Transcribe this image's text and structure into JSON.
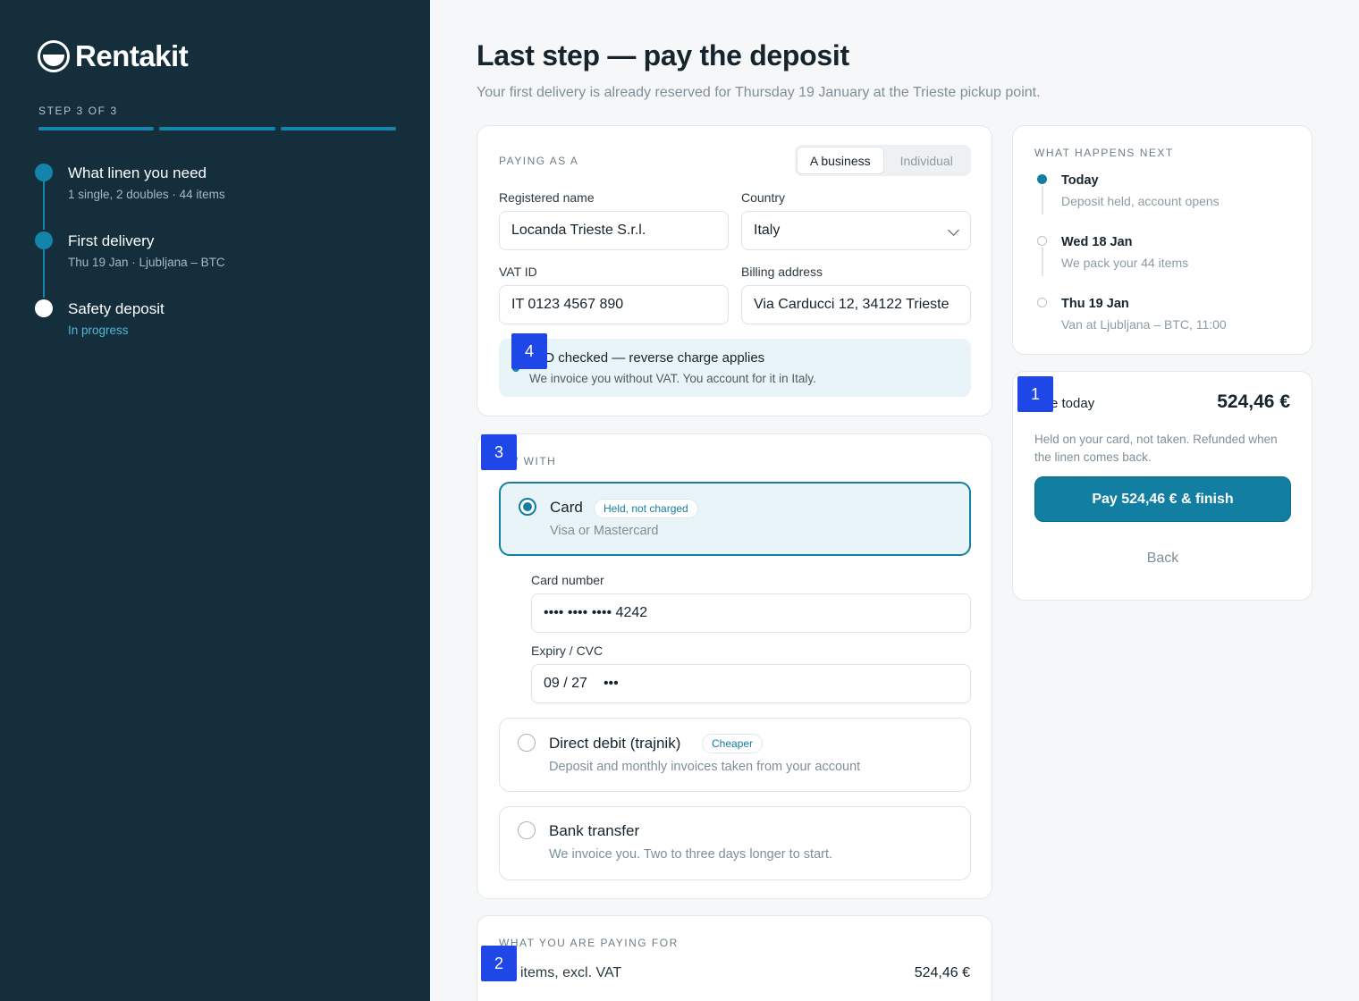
{
  "brand": {
    "name": "Rentakit"
  },
  "sidebar": {
    "step_label": "STEP 3 OF 3",
    "steps": [
      {
        "title": "What linen you need",
        "sub": "1 single, 2 doubles · 44 items"
      },
      {
        "title": "First delivery",
        "sub": "Thu 19 Jan · Ljubljana – BTC"
      },
      {
        "title": "Safety deposit",
        "sub": "In progress"
      }
    ]
  },
  "header": {
    "title": "Last step — pay the deposit",
    "subtitle": "Your first delivery is already reserved for Thursday 19 January at the Trieste pickup point."
  },
  "paying_as": {
    "label": "PAYING AS A",
    "options": [
      "A business",
      "Individual"
    ],
    "selected": "A business",
    "registered_name_label": "Registered name",
    "registered_name": "Locanda Trieste S.r.l.",
    "country_label": "Country",
    "country": "Italy",
    "vat_label": "VAT ID",
    "vat": "IT 0123 4567 890",
    "billing_label": "Billing address",
    "billing": "Via Carducci 12, 34122 Trieste",
    "vat_note_title": "T ID checked — reverse charge applies",
    "vat_note_sub": "We invoice you without VAT. You account for it in Italy."
  },
  "pay_with": {
    "label": "/ WITH",
    "card": {
      "title": "Card",
      "badge": "Held, not charged",
      "sub": "Visa or Mastercard"
    },
    "card_number_label": "Card number",
    "card_number": "•••• •••• •••• 4242",
    "expiry_label": "Expiry / CVC",
    "expiry": "09 / 27",
    "cvc": "•••",
    "debit": {
      "title": "Direct debit (trajnik)",
      "badge": "Cheaper",
      "sub": "Deposit and monthly invoices taken from your account"
    },
    "bank": {
      "title": "Bank transfer",
      "sub": "We invoice you. Two to three days longer to start."
    }
  },
  "paying_for": {
    "label": "WHAT YOU ARE PAYING FOR",
    "line_label": "items, excl. VAT",
    "line_amount": "524,46 €"
  },
  "next": {
    "label": "WHAT HAPPENS NEXT",
    "items": [
      {
        "title": "Today",
        "sub": "Deposit held, account opens"
      },
      {
        "title": "Wed 18 Jan",
        "sub": "We pack your 44 items"
      },
      {
        "title": "Thu 19 Jan",
        "sub": "Van at Ljubljana – BTC, 11:00"
      }
    ]
  },
  "due": {
    "label": "e today",
    "amount": "524,46 €",
    "note": "Held on your card, not taken. Refunded when the linen comes back.",
    "pay_button": "Pay 524,46 € & finish",
    "back_button": "Back"
  },
  "markers": [
    "1",
    "2",
    "3",
    "4"
  ],
  "colors": {
    "sidebar": "#142e3b",
    "accent": "#127ea1",
    "marker": "#1f47e8"
  }
}
